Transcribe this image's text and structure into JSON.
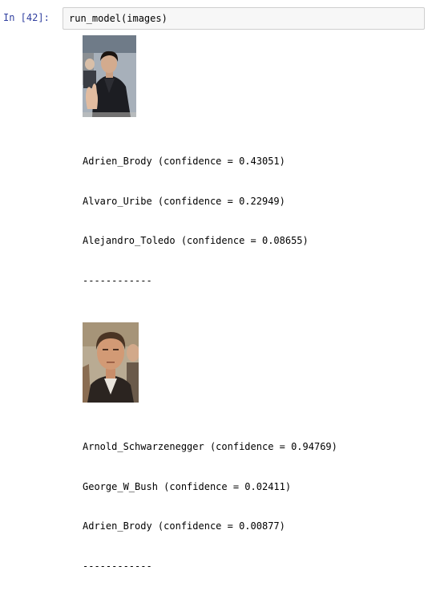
{
  "cell": {
    "prompt": "In [42]:",
    "code": "run_model(images)"
  },
  "results": [
    {
      "thumbnail": "portrait-photo",
      "predictions": [
        "Adrien_Brody (confidence = 0.43051)",
        "Alvaro_Uribe (confidence = 0.22949)",
        "Alejandro_Toledo (confidence = 0.08655)"
      ],
      "separator": "------------"
    },
    {
      "thumbnail": "portrait-photo",
      "predictions": [
        "Arnold_Schwarzenegger (confidence = 0.94769)",
        "George_W_Bush (confidence = 0.02411)",
        "Adrien_Brody (confidence = 0.00877)"
      ],
      "separator": "------------"
    }
  ],
  "colors": {
    "prompt": "#303f9f",
    "input_background": "#f7f7f7",
    "input_border": "#cfcfcf"
  }
}
